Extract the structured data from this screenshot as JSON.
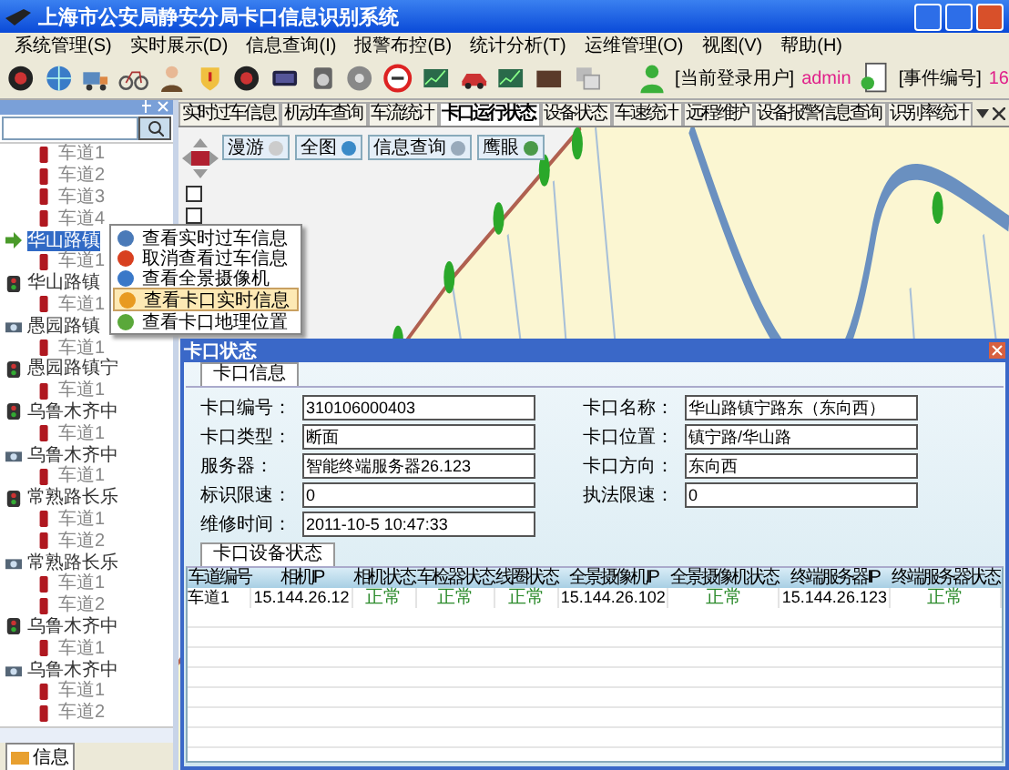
{
  "window": {
    "title": "上海市公安局静安分局卡口信息识别系统"
  },
  "menu": [
    "系统管理(S)",
    "实时展示(D)",
    "信息查询(I)",
    "报警布控(B)",
    "统计分析(T)",
    "运维管理(O)",
    "视图(V)",
    "帮助(H)"
  ],
  "toolbar": {
    "user_label": "[当前登录用户]",
    "user": "admin",
    "event_label": "[事件编号]",
    "event": "16"
  },
  "side_panel": {
    "tab": "信息",
    "tree": [
      {
        "kind": "lane",
        "label": "车道1",
        "selected": false
      },
      {
        "kind": "lane",
        "label": "车道2",
        "selected": false
      },
      {
        "kind": "lane",
        "label": "车道3",
        "selected": false
      },
      {
        "kind": "lane",
        "label": "车道4",
        "selected": false
      },
      {
        "kind": "signal",
        "label": "华山路镇",
        "selected": true,
        "children": [
          {
            "kind": "lane",
            "label": "车道1",
            "selected": false
          }
        ]
      },
      {
        "kind": "signal",
        "label": "华山路镇",
        "selected": false,
        "children": [
          {
            "kind": "lane",
            "label": "车道1",
            "selected": false
          }
        ]
      },
      {
        "kind": "camera",
        "label": "愚园路镇",
        "selected": false,
        "children": [
          {
            "kind": "lane",
            "label": "车道1",
            "selected": false
          }
        ]
      },
      {
        "kind": "signal",
        "label": "愚园路镇宁",
        "selected": false,
        "children": [
          {
            "kind": "lane",
            "label": "车道1",
            "selected": false
          }
        ]
      },
      {
        "kind": "signal",
        "label": "乌鲁木齐中",
        "selected": false,
        "children": [
          {
            "kind": "lane",
            "label": "车道1",
            "selected": false
          }
        ]
      },
      {
        "kind": "camera",
        "label": "乌鲁木齐中",
        "selected": false,
        "children": [
          {
            "kind": "lane",
            "label": "车道1",
            "selected": false
          }
        ]
      },
      {
        "kind": "signal",
        "label": "常熟路长乐",
        "selected": false,
        "children": [
          {
            "kind": "lane",
            "label": "车道1",
            "selected": false
          },
          {
            "kind": "lane",
            "label": "车道2",
            "selected": false
          }
        ]
      },
      {
        "kind": "camera",
        "label": "常熟路长乐",
        "selected": false,
        "children": [
          {
            "kind": "lane",
            "label": "车道1",
            "selected": false
          },
          {
            "kind": "lane",
            "label": "车道2",
            "selected": false
          }
        ]
      },
      {
        "kind": "signal",
        "label": "乌鲁木齐中",
        "selected": false,
        "children": [
          {
            "kind": "lane",
            "label": "车道1",
            "selected": false
          }
        ]
      },
      {
        "kind": "camera",
        "label": "乌鲁木齐中",
        "selected": false,
        "children": [
          {
            "kind": "lane",
            "label": "车道1",
            "selected": false
          },
          {
            "kind": "lane",
            "label": "车道2",
            "selected": false
          }
        ]
      }
    ]
  },
  "tabs": [
    {
      "label": "实时过车信息",
      "selected": false
    },
    {
      "label": "机动车查询",
      "selected": false
    },
    {
      "label": "车流统计",
      "selected": false
    },
    {
      "label": "卡口运行状态",
      "selected": true
    },
    {
      "label": "设备状态",
      "selected": false
    },
    {
      "label": "车速统计",
      "selected": false
    },
    {
      "label": "远程维护",
      "selected": false
    },
    {
      "label": "设备报警信息查询",
      "selected": false
    },
    {
      "label": "识别率统计",
      "selected": false
    }
  ],
  "map": {
    "tools": [
      "漫游",
      "全图",
      "信息查询",
      "鹰眼"
    ]
  },
  "context_menu": [
    {
      "label": "查看实时过车信息",
      "selected": false
    },
    {
      "label": "取消查看过车信息",
      "selected": false
    },
    {
      "label": "查看全景摄像机",
      "selected": false
    },
    {
      "label": "查看卡口实时信息",
      "selected": true
    },
    {
      "label": "查看卡口地理位置",
      "selected": false
    }
  ],
  "dialog": {
    "title": "卡口状态",
    "info_tab": "卡口信息",
    "left_fields": [
      {
        "label": "卡口编号：",
        "value": "310106000403"
      },
      {
        "label": "卡口类型：",
        "value": "断面"
      },
      {
        "label": "服务器：",
        "value": "智能终端服务器26.123"
      },
      {
        "label": "标识限速：",
        "value": "0"
      },
      {
        "label": "维修时间：",
        "value": "2011-10-5 10:47:33"
      }
    ],
    "right_fields": [
      {
        "label": "卡口名称：",
        "value": "华山路镇宁路东（东向西）"
      },
      {
        "label": "卡口位置：",
        "value": "镇宁路/华山路"
      },
      {
        "label": "卡口方向：",
        "value": "东向西"
      },
      {
        "label": "执法限速：",
        "value": "0"
      }
    ],
    "device_tab": "卡口设备状态",
    "table": {
      "columns": [
        {
          "label": "车道编号",
          "kind": "text"
        },
        {
          "label": "相机IP",
          "kind": "text"
        },
        {
          "label": "相机状态",
          "kind": "status"
        },
        {
          "label": "车检器状态",
          "kind": "status"
        },
        {
          "label": "线圈状态",
          "kind": "status"
        },
        {
          "label": "全景摄像机IP",
          "kind": "text"
        },
        {
          "label": "全景摄像机状态",
          "kind": "status"
        },
        {
          "label": "终端服务器IP",
          "kind": "text"
        },
        {
          "label": "终端服务器状态",
          "kind": "status"
        }
      ],
      "rows": [
        [
          "车道1",
          "15.144.26.12",
          "正常",
          "正常",
          "正常",
          "15.144.26.102",
          "正常",
          "15.144.26.123",
          "正常"
        ]
      ]
    }
  }
}
